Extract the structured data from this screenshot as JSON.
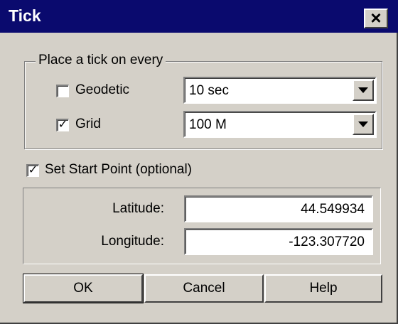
{
  "window": {
    "title": "Tick",
    "close_label": "×"
  },
  "tick_group": {
    "legend": "Place a tick on every",
    "geodetic": {
      "label": "Geodetic",
      "checked": false,
      "check_mark": "",
      "selected": "10 sec"
    },
    "grid": {
      "label": "Grid",
      "checked": true,
      "check_mark": "✓",
      "selected": "100 M"
    }
  },
  "start_point": {
    "label": "Set Start Point (optional)",
    "checked": true,
    "check_mark": "✓"
  },
  "coordinates": {
    "latitude_label": "Latitude:",
    "latitude_value": "44.549934",
    "longitude_label": "Longitude:",
    "longitude_value": "-123.307720"
  },
  "buttons": {
    "ok": "OK",
    "cancel": "Cancel",
    "help": "Help"
  },
  "colors": {
    "title_bar": "#0a0a6e",
    "face": "#d4d0c8",
    "title_text": "#ffffff"
  }
}
